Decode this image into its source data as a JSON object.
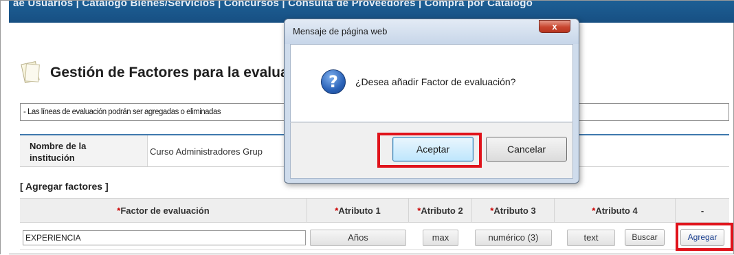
{
  "nav": {
    "text": "ae Usuarios  |  Catalogo Bienes/Servicios  |  Concursos  |  Consulta de Proveedores  |  Compra por Catalogo"
  },
  "page": {
    "title": "Gestión de Factores para la evalua",
    "info": "- Las líneas de evaluación podrán ser agregadas o eliminadas",
    "institution_label": "Nombre de la institución",
    "institution_value": "Curso Administradores Grup",
    "section_label": "[ Agregar factores ]"
  },
  "table": {
    "headers": [
      {
        "req": "*",
        "label": "Factor de evaluación"
      },
      {
        "req": "*",
        "label": "Atributo 1"
      },
      {
        "req": "*",
        "label": "Atributo 2"
      },
      {
        "req": "*",
        "label": "Atributo 3"
      },
      {
        "req": "*",
        "label": "Atributo 4"
      },
      {
        "req": "",
        "label": "-"
      }
    ],
    "row": {
      "factor": "EXPERIENCIA",
      "attr1": "Años",
      "attr2": "max",
      "attr3": "numérico (3)",
      "attr4": "text",
      "buscar": "Buscar",
      "agregar": "Agregar"
    }
  },
  "dialog": {
    "title": "Mensaje de página web",
    "close": "x",
    "icon": "question-icon",
    "message": "¿Desea añadir Factor de evaluación?",
    "accept": "Aceptar",
    "cancel": "Cancelar"
  },
  "colors": {
    "highlight": "#e0131b",
    "nav": "#1d5f95"
  }
}
